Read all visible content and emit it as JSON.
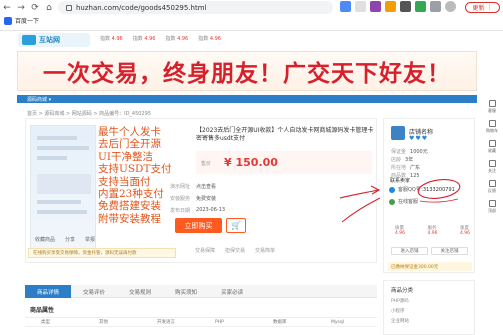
{
  "browser": {
    "url": "huzhan.com/code/goods450295.html",
    "bookmark_label": "百度一下",
    "update_label": "更新"
  },
  "site": {
    "logo_text": "互站网",
    "ticker": [
      {
        "label": "指数",
        "value": "4.96"
      },
      {
        "label": "指数",
        "value": "4.96"
      },
      {
        "label": "指数",
        "value": "4.96"
      },
      {
        "label": "指数",
        "value": "4.96"
      }
    ]
  },
  "banner": {
    "text": "一次交易，终身朋友！广交天下好友！"
  },
  "catnav": {
    "label": "源码商城 ▾"
  },
  "breadcrumb": "首页 > 源码商城 > 网站源码 > 商品编号：ID_450295",
  "product": {
    "promo_lines": [
      "最牛个人发卡",
      "去后门全开源",
      "UI干净整洁",
      "支持USDT支付",
      "支持当面付",
      "内置23种支付",
      "免费搭建安装",
      "附带安装教程"
    ],
    "title": "【2023去后门全开源UI收款】个人自动发卡网商城源码发卡管理卡密寄售多usdt支付",
    "price_label": "售价",
    "price": "¥ 150.00",
    "meta": [
      {
        "label": "演示网址",
        "value": "点击查看"
      },
      {
        "label": "安装服务",
        "value": "免费安装"
      },
      {
        "label": "发布日期",
        "value": "2023-06-13"
      }
    ],
    "buy_label": "立即购买",
    "cart_icon": "cart-icon",
    "share_items": [
      "收藏商品",
      "分享",
      "举报"
    ],
    "notice": "在线购买享受交易保障，资金托管，源码无误再付款",
    "guarantees": [
      "交易保障",
      "担保交易",
      "交易简单"
    ]
  },
  "shop": {
    "name": "店铺名称",
    "level": "♥♥♥",
    "lines": [
      {
        "label": "保证金",
        "value": "1000元"
      },
      {
        "label": "店龄",
        "value": "3年"
      },
      {
        "label": "所在地",
        "value": "广东"
      },
      {
        "label": "商品数",
        "value": "125"
      }
    ],
    "contact_head": "联系卖家",
    "qq_label": "客服QQ号：",
    "qq_number": "3133200791",
    "wechat_label": "在线客服",
    "stats": [
      {
        "label": "质量",
        "value": "4.96"
      },
      {
        "label": "服务",
        "value": "4.96"
      },
      {
        "label": "速度",
        "value": "4.96"
      }
    ],
    "btn_enter": "进入店铺",
    "btn_follow": "关注店铺",
    "guarantee": "已缴纳保证金300.00元"
  },
  "tabs": [
    "商品详情",
    "交易评价",
    "交易规则",
    "购买须知",
    "买家必读"
  ],
  "spec": {
    "title": "商品属性",
    "rows": [
      [
        "类型",
        "其他",
        "开发语言",
        "PHP",
        "数据库",
        "Mysql"
      ]
    ]
  },
  "side_block": {
    "title": "商品分类",
    "lines": [
      "PHP源码",
      "小程序",
      "企业网站"
    ]
  },
  "floatbar": [
    "客服",
    "购物车",
    "收藏",
    "关注",
    "反馈",
    "顶部"
  ]
}
